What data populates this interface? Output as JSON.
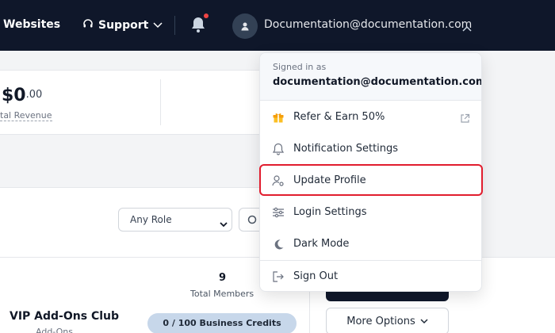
{
  "navbar": {
    "websites_label": "Websites",
    "support_label": "Support",
    "user_email": "Documentation@documentation.com"
  },
  "stats": {
    "revenue_whole": "$0",
    "revenue_cents": ".00",
    "revenue_label": "tal Revenue"
  },
  "filters": {
    "role_select_value": "Any Role"
  },
  "row": {
    "members_count": "9",
    "members_label": "Total Members",
    "club_name": "VIP Add-Ons Club",
    "club_sub": "Add-Ons",
    "credits_label": "0 / 100 Business Credits",
    "more_options_label": "More Options"
  },
  "user_menu": {
    "signed_in_label": "Signed in as",
    "signed_in_email": "documentation@documentation.com",
    "items": [
      {
        "label": "Refer & Earn 50%",
        "icon": "gift-icon"
      },
      {
        "label": "Notification Settings",
        "icon": "bell-icon"
      },
      {
        "label": "Update Profile",
        "icon": "user-settings-icon"
      },
      {
        "label": "Login Settings",
        "icon": "sliders-icon"
      },
      {
        "label": "Dark Mode",
        "icon": "moon-icon"
      },
      {
        "label": "Sign Out",
        "icon": "sign-out-icon"
      }
    ]
  },
  "colors": {
    "navbar_bg": "#0f172a",
    "highlight": "#e11d2e",
    "gift_accent": "#f59e0b"
  }
}
